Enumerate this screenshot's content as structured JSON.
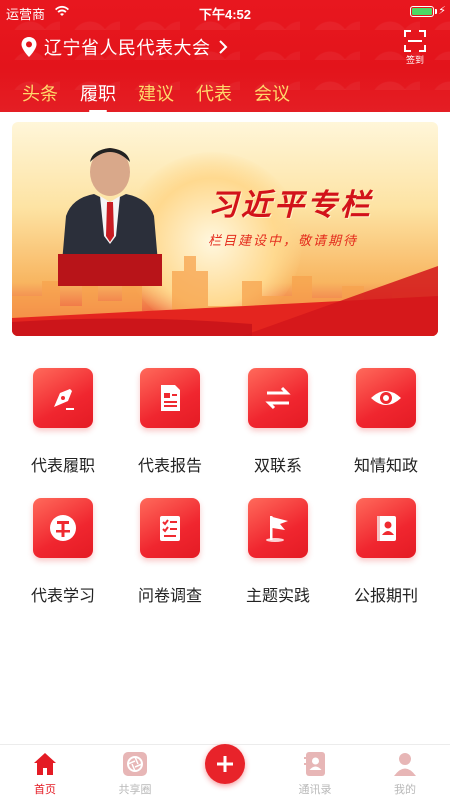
{
  "status_bar": {
    "carrier": "运营商",
    "time": "下午4:52"
  },
  "header": {
    "location": "辽宁省人民代表大会",
    "signin_label": "签到",
    "tabs": [
      {
        "label": "头条",
        "active": false
      },
      {
        "label": "履职",
        "active": true
      },
      {
        "label": "建议",
        "active": false
      },
      {
        "label": "代表",
        "active": false
      },
      {
        "label": "会议",
        "active": false
      }
    ]
  },
  "banner": {
    "title": "习近平专栏",
    "subtitle": "栏目建设中，敬请期待"
  },
  "grid": [
    {
      "label": "代表履职",
      "icon": "pen-icon"
    },
    {
      "label": "代表报告",
      "icon": "document-icon"
    },
    {
      "label": "双联系",
      "icon": "exchange-arrows-icon"
    },
    {
      "label": "知情知政",
      "icon": "eye-icon"
    },
    {
      "label": "代表学习",
      "icon": "study-icon"
    },
    {
      "label": "问卷调查",
      "icon": "checklist-icon"
    },
    {
      "label": "主题实践",
      "icon": "flag-icon"
    },
    {
      "label": "公报期刊",
      "icon": "journal-icon"
    }
  ],
  "tabbar": {
    "items": [
      {
        "label": "首页",
        "active": true
      },
      {
        "label": "共享圈",
        "active": false
      },
      {
        "label": "通讯录",
        "active": false
      },
      {
        "label": "我的",
        "active": false
      }
    ]
  },
  "colors": {
    "brand_red": "#e41b24",
    "tab_inactive": "#ffd86b"
  }
}
